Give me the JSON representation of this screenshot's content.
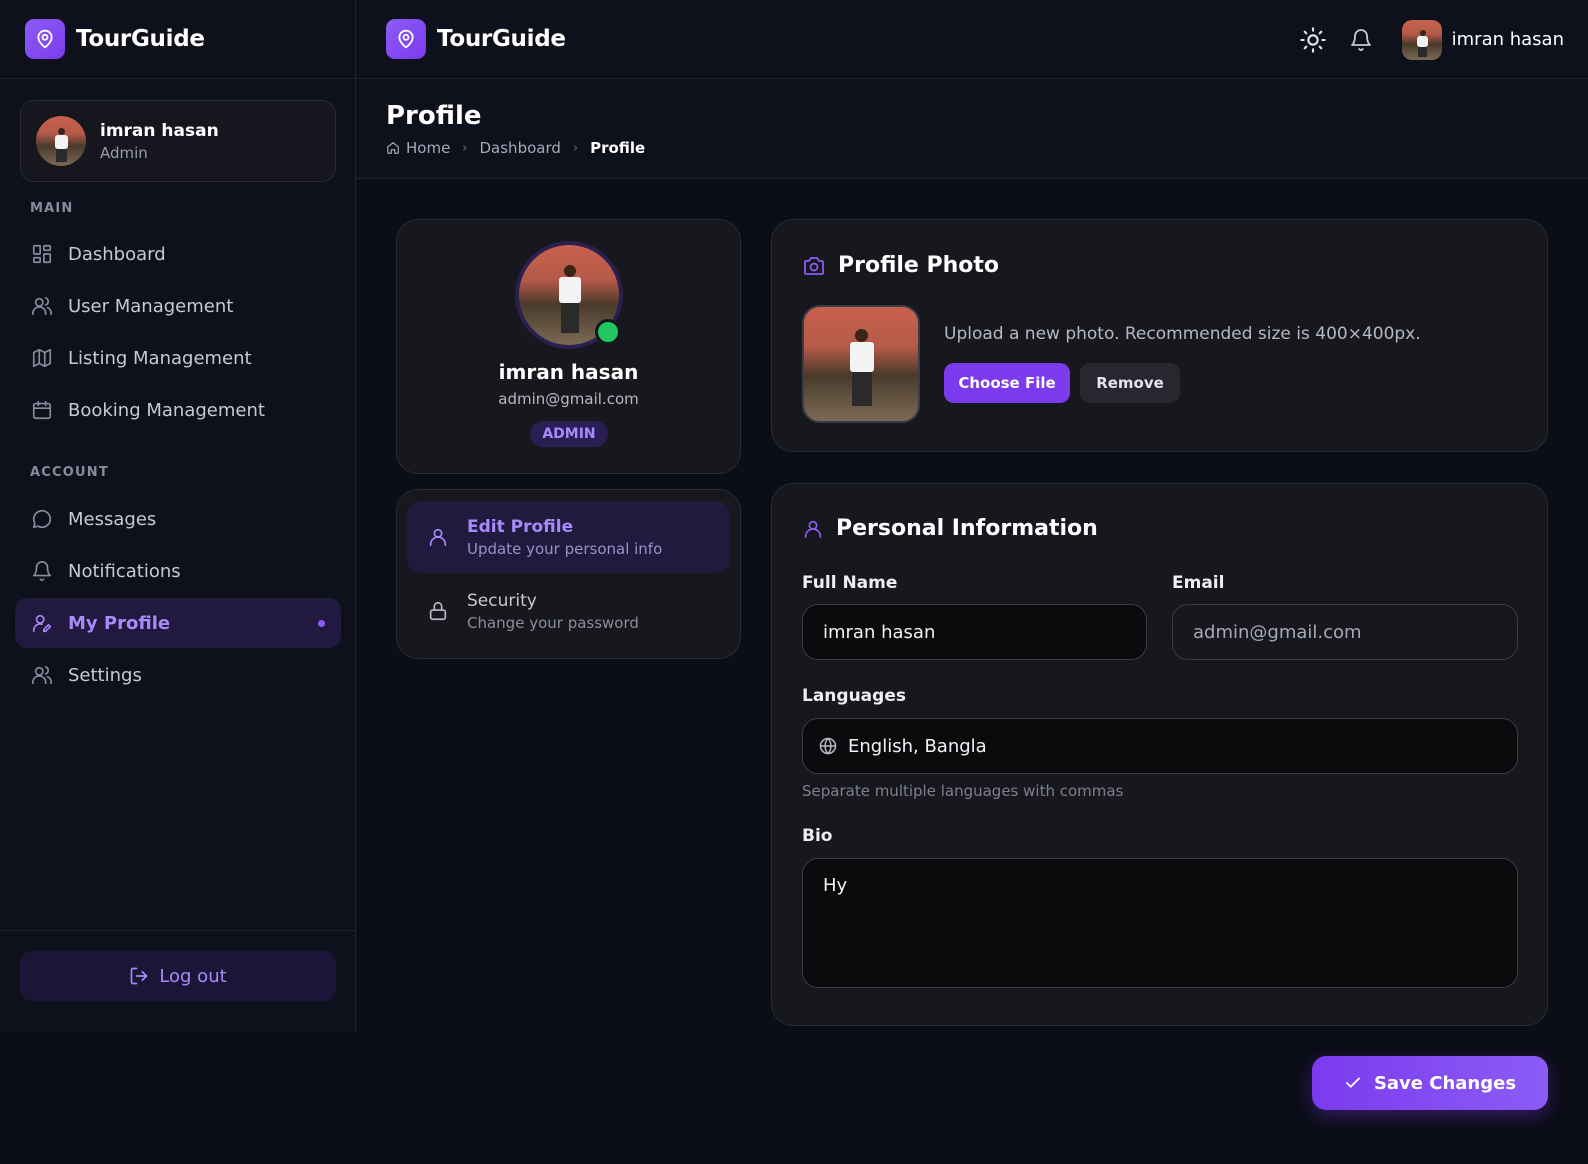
{
  "brand": {
    "name": "TourGuide",
    "icon": "map-pin-icon",
    "accent": "#7c3aed"
  },
  "topbar": {
    "user_name": "imran hasan",
    "theme_icon": "sun-icon",
    "notif_icon": "bell-icon"
  },
  "sidebar": {
    "user": {
      "name": "imran hasan",
      "role": "Admin"
    },
    "sections": [
      {
        "label": "MAIN",
        "items": [
          {
            "label": "Dashboard",
            "icon": "grid-icon"
          },
          {
            "label": "User Management",
            "icon": "users-icon"
          },
          {
            "label": "Listing Management",
            "icon": "map-icon"
          },
          {
            "label": "Booking Management",
            "icon": "calendar-icon"
          }
        ]
      },
      {
        "label": "ACCOUNT",
        "items": [
          {
            "label": "Messages",
            "icon": "message-icon"
          },
          {
            "label": "Notifications",
            "icon": "bell-icon"
          },
          {
            "label": "My Profile",
            "icon": "user-edit-icon",
            "active": true
          },
          {
            "label": "Settings",
            "icon": "users-icon"
          }
        ]
      }
    ],
    "logout_label": "Log out"
  },
  "page": {
    "title": "Profile",
    "breadcrumb": [
      "Home",
      "Dashboard",
      "Profile"
    ]
  },
  "profile_card": {
    "name": "imran hasan",
    "email": "admin@gmail.com",
    "badge": "ADMIN",
    "status_color": "#22c55e"
  },
  "profile_menu": [
    {
      "title": "Edit Profile",
      "subtitle": "Update your personal info",
      "icon": "user-icon",
      "active": true
    },
    {
      "title": "Security",
      "subtitle": "Change your password",
      "icon": "lock-icon"
    }
  ],
  "photo_section": {
    "title": "Profile Photo",
    "hint": "Upload a new photo. Recommended size is 400×400px.",
    "choose_label": "Choose File",
    "remove_label": "Remove"
  },
  "personal_info": {
    "title": "Personal Information",
    "full_name_label": "Full Name",
    "full_name_value": "imran hasan",
    "email_label": "Email",
    "email_value": "admin@gmail.com",
    "languages_label": "Languages",
    "languages_value": "English, Bangla",
    "languages_hint": "Separate multiple languages with commas",
    "bio_label": "Bio",
    "bio_value": "Hy"
  },
  "save_label": "Save Changes"
}
